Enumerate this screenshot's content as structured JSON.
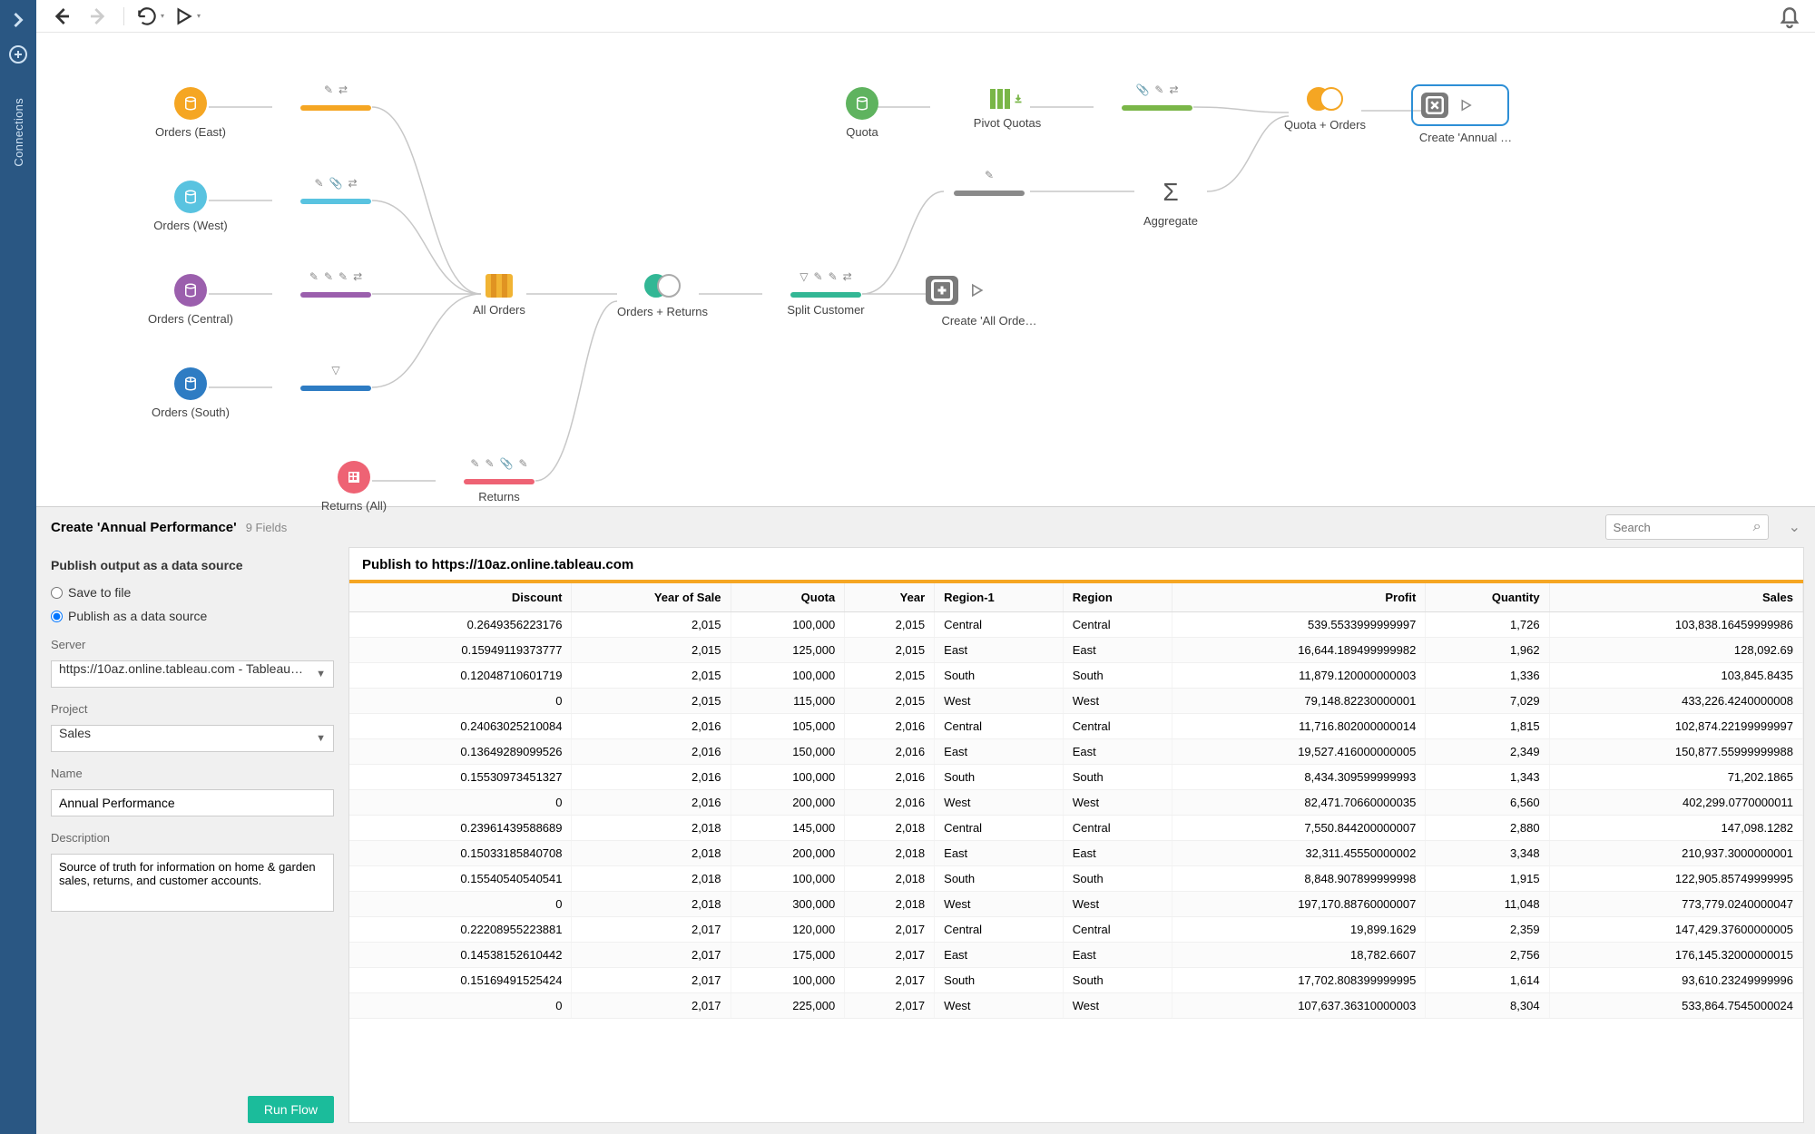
{
  "rail": {
    "label": "Connections"
  },
  "flow": {
    "nodes": {
      "orders_east": "Orders (East)",
      "orders_west": "Orders (West)",
      "orders_central": "Orders (Central)",
      "orders_south": "Orders (South)",
      "returns_all": "Returns (All)",
      "all_orders": "All Orders",
      "returns": "Returns",
      "orders_plus_returns": "Orders + Returns",
      "split_customer": "Split Customer",
      "create_all_orders": "Create 'All Orde…",
      "quota": "Quota",
      "pivot_quotas": "Pivot Quotas",
      "aggregate": "Aggregate",
      "quota_plus_orders": "Quota + Orders",
      "create_annual": "Create 'Annual …"
    }
  },
  "panel": {
    "title": "Create 'Annual Performance'",
    "fields_count": "9 Fields",
    "search_placeholder": "Search",
    "publish_section": "Publish output as a data source",
    "opt_save": "Save to file",
    "opt_publish": "Publish as a data source",
    "server_label": "Server",
    "server_value": "https://10az.online.tableau.com - Tableau…",
    "project_label": "Project",
    "project_value": "Sales",
    "name_label": "Name",
    "name_value": "Annual Performance",
    "desc_label": "Description",
    "desc_value": "Source of truth for information on home & garden sales, returns, and customer accounts.",
    "run_label": "Run Flow",
    "publish_to": "Publish to https://10az.online.tableau.com"
  },
  "table": {
    "columns": [
      "Discount",
      "Year of Sale",
      "Quota",
      "Year",
      "Region-1",
      "Region",
      "Profit",
      "Quantity",
      "Sales"
    ],
    "rows": [
      [
        "0.2649356223176",
        "2,015",
        "100,000",
        "2,015",
        "Central",
        "Central",
        "539.5533999999997",
        "1,726",
        "103,838.16459999986"
      ],
      [
        "0.15949119373777",
        "2,015",
        "125,000",
        "2,015",
        "East",
        "East",
        "16,644.189499999982",
        "1,962",
        "128,092.69"
      ],
      [
        "0.12048710601719",
        "2,015",
        "100,000",
        "2,015",
        "South",
        "South",
        "11,879.120000000003",
        "1,336",
        "103,845.8435"
      ],
      [
        "0",
        "2,015",
        "115,000",
        "2,015",
        "West",
        "West",
        "79,148.82230000001",
        "7,029",
        "433,226.4240000008"
      ],
      [
        "0.24063025210084",
        "2,016",
        "105,000",
        "2,016",
        "Central",
        "Central",
        "11,716.802000000014",
        "1,815",
        "102,874.22199999997"
      ],
      [
        "0.13649289099526",
        "2,016",
        "150,000",
        "2,016",
        "East",
        "East",
        "19,527.416000000005",
        "2,349",
        "150,877.55999999988"
      ],
      [
        "0.15530973451327",
        "2,016",
        "100,000",
        "2,016",
        "South",
        "South",
        "8,434.309599999993",
        "1,343",
        "71,202.1865"
      ],
      [
        "0",
        "2,016",
        "200,000",
        "2,016",
        "West",
        "West",
        "82,471.70660000035",
        "6,560",
        "402,299.0770000011"
      ],
      [
        "0.23961439588689",
        "2,018",
        "145,000",
        "2,018",
        "Central",
        "Central",
        "7,550.844200000007",
        "2,880",
        "147,098.1282"
      ],
      [
        "0.15033185840708",
        "2,018",
        "200,000",
        "2,018",
        "East",
        "East",
        "32,311.45550000002",
        "3,348",
        "210,937.3000000001"
      ],
      [
        "0.15540540540541",
        "2,018",
        "100,000",
        "2,018",
        "South",
        "South",
        "8,848.907899999998",
        "1,915",
        "122,905.85749999995"
      ],
      [
        "0",
        "2,018",
        "300,000",
        "2,018",
        "West",
        "West",
        "197,170.88760000007",
        "11,048",
        "773,779.0240000047"
      ],
      [
        "0.22208955223881",
        "2,017",
        "120,000",
        "2,017",
        "Central",
        "Central",
        "19,899.1629",
        "2,359",
        "147,429.37600000005"
      ],
      [
        "0.14538152610442",
        "2,017",
        "175,000",
        "2,017",
        "East",
        "East",
        "18,782.6607",
        "2,756",
        "176,145.32000000015"
      ],
      [
        "0.15169491525424",
        "2,017",
        "100,000",
        "2,017",
        "South",
        "South",
        "17,702.808399999995",
        "1,614",
        "93,610.23249999996"
      ],
      [
        "0",
        "2,017",
        "225,000",
        "2,017",
        "West",
        "West",
        "107,637.36310000003",
        "8,304",
        "533,864.7545000024"
      ]
    ]
  }
}
